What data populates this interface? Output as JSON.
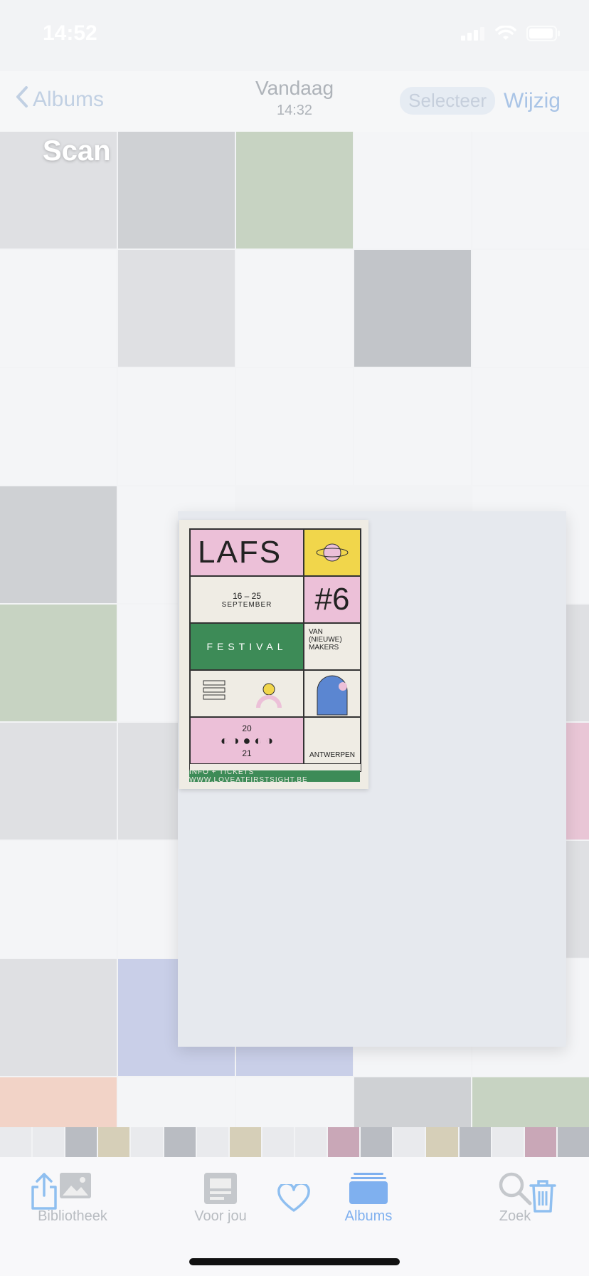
{
  "status_bar": {
    "time": "14:52"
  },
  "nav": {
    "back_label": "Albums",
    "title": "Vandaag",
    "subtitle": "14:32",
    "select_label": "Selecteer",
    "edit_label": "Wijzig"
  },
  "album_title": "Scan",
  "poster": {
    "title": "LAFS",
    "number": "#6",
    "dates": "16 – 25",
    "month": "SEPTEMBER",
    "festival": "FESTIVAL",
    "makers": "VAN (NIEUWE) MAKERS",
    "year_top": "20",
    "year_bottom": "21",
    "city": "ANTWERPEN",
    "footer": "INFO + TICKETS  WWW.LOVEATFIRSTSIGHT.BE"
  },
  "tabs": [
    {
      "label": "Bibliotheek",
      "icon": "photo-library-icon"
    },
    {
      "label": "Voor jou",
      "icon": "for-you-icon"
    },
    {
      "label": "Albums",
      "icon": "albums-icon"
    },
    {
      "label": "Zoek",
      "icon": "search-icon"
    }
  ],
  "colors": {
    "accent": "#007AFF",
    "poster_pink": "#ECC0D8",
    "poster_green": "#3D8B57",
    "poster_yellow": "#F1D64B"
  }
}
